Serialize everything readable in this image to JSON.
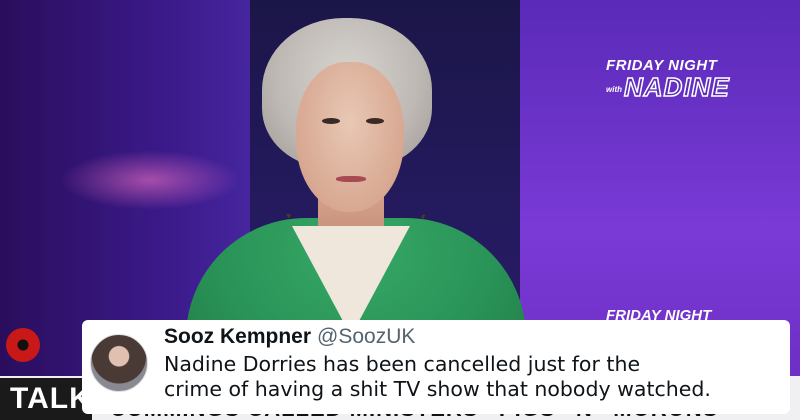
{
  "broadcast": {
    "show_logo_line1": "FRIDAY NIGHT",
    "show_logo_with": "with",
    "show_logo_name": "NADINE",
    "show_logo_repeat": "FRIDAY NIGHT",
    "channel_logo": "TALK",
    "ticker_text": "CUMMINGS CALLED MINISTERS ' PIGS ' N ' MORONS '"
  },
  "tweet": {
    "display_name": "Sooz Kempner",
    "handle": "@SoozUK",
    "text_line1": "Nadine Dorries has been cancelled just for the",
    "text_line2": "crime of having a shit TV show that nobody watched."
  },
  "colors": {
    "studio_purple": "#6a2cc0",
    "jacket_green": "#2a9458",
    "ticker_bg": "#f0f0f2",
    "tweet_bg": "#ffffff",
    "handle_gray": "#536471"
  },
  "icons": {
    "poppy": "poppy-icon",
    "avatar": "avatar-photo"
  }
}
